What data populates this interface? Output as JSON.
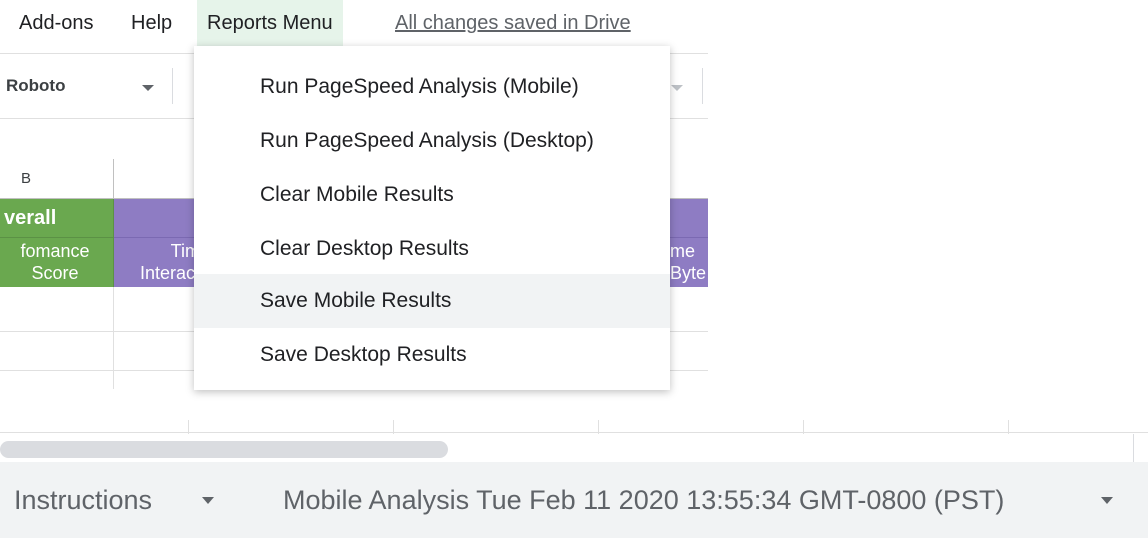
{
  "menubar": {
    "items": [
      "Add-ons",
      "Help",
      "Reports Menu"
    ],
    "saved_status": "All changes saved in Drive"
  },
  "toolbar": {
    "font": "Roboto"
  },
  "sheet": {
    "column_label": "B",
    "overall_header": "verall",
    "green_header": [
      "fomance",
      "Score"
    ],
    "purple_left": [
      "Tim",
      "Interact"
    ],
    "purple_right": [
      "me",
      "Byte"
    ],
    "colors": {
      "green": "#6aa84f",
      "purple": "#8e7cc3"
    }
  },
  "reports_menu": {
    "items": [
      "Run PageSpeed Analysis (Mobile)",
      "Run PageSpeed Analysis (Desktop)",
      "Clear Mobile Results",
      "Clear Desktop Results",
      "Save Mobile Results",
      "Save Desktop Results"
    ],
    "highlighted": "Save Mobile Results"
  },
  "tabs": {
    "items": [
      "Instructions",
      "Mobile Analysis Tue Feb 11 2020 13:55:34 GMT-0800 (PST)"
    ]
  }
}
